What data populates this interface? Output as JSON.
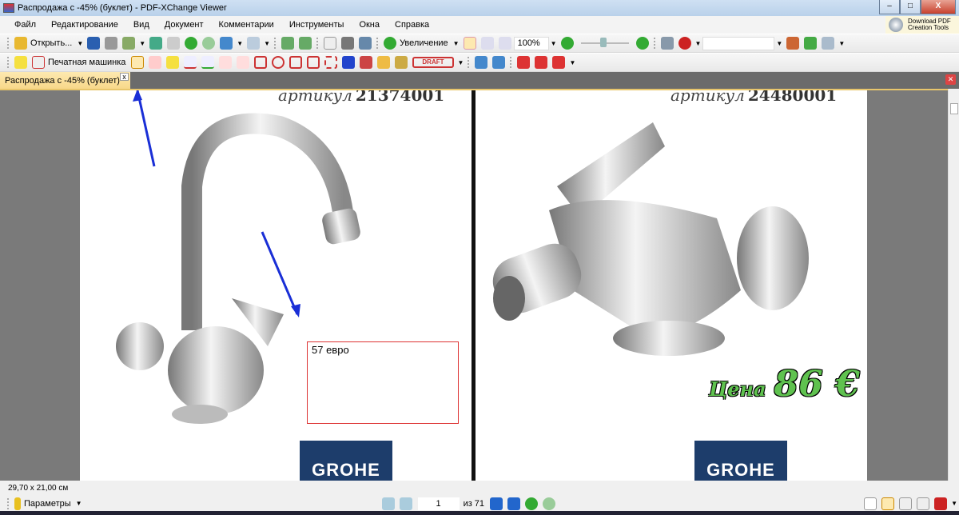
{
  "window": {
    "title": "Распродажа с -45% (буклет) - PDF-XChange Viewer",
    "minimize": "–",
    "maximize": "□",
    "close": "X"
  },
  "menu": [
    "Файл",
    "Редактирование",
    "Вид",
    "Документ",
    "Комментарии",
    "Инструменты",
    "Окна",
    "Справка"
  ],
  "download_pdf": {
    "line1": "Download PDF",
    "line2": "Creation Tools"
  },
  "toolbar1": {
    "open_label": "Открыть...",
    "zoom_label": "Увеличение",
    "zoom_value": "100%",
    "search_value": ""
  },
  "toolbar2": {
    "typewriter_label": "Печатная машинка",
    "stamp_label": "DRAFT"
  },
  "tab": {
    "label": "Распродажа с -45% (буклет)",
    "close": "x"
  },
  "page_left": {
    "article_label": "артикул",
    "article_number": "21374001",
    "annotation_text": "57 евро",
    "brand": "GROHE"
  },
  "page_right": {
    "article_label": "артикул",
    "article_number": "24480001",
    "price_word": "Цена",
    "price_value": "86 €",
    "brand": "GROHE"
  },
  "status": {
    "page_size": "29,70 x 21,00 см"
  },
  "bottom": {
    "params_label": "Параметры",
    "current_page": "1",
    "of_pages": "из 71"
  },
  "colors": {
    "accent_tab": "#f8d889",
    "annotation_border": "#dd3333",
    "arrow": "#1a2fd6",
    "grohe": "#1d3d6b",
    "price_green": "#5fc24f"
  }
}
